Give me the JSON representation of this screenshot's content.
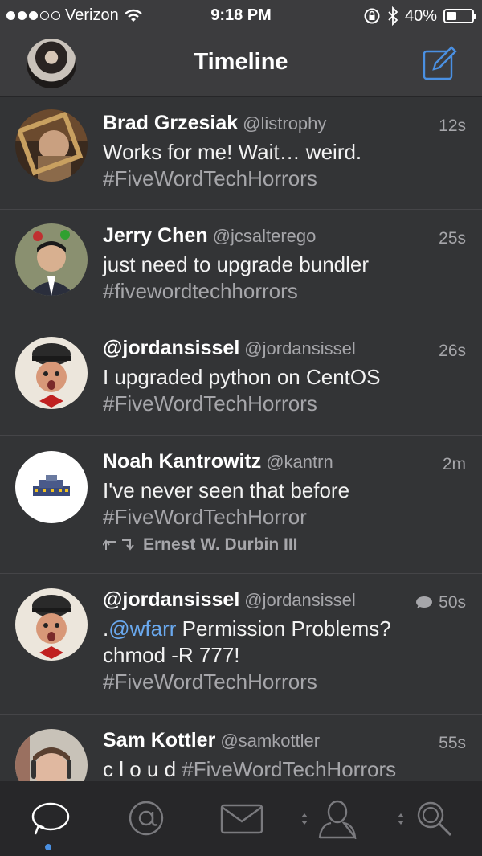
{
  "status": {
    "carrier": "Verizon",
    "time": "9:18 PM",
    "battery": "40%",
    "battery_level": 0.4
  },
  "nav": {
    "title": "Timeline"
  },
  "colors": {
    "accent": "#4a90e2",
    "mention": "#6aa9ef",
    "muted": "#a6a6aa"
  },
  "tweets": [
    {
      "name": "Brad Grzesiak",
      "handle": "@listrophy",
      "time": "12s",
      "text": "Works for me! Wait… weird.",
      "hashtag": "#FiveWordTechHorrors"
    },
    {
      "name": "Jerry Chen",
      "handle": "@jcsalterego",
      "time": "25s",
      "text": "just need to upgrade bundler",
      "hashtag": "#fivewordtechhorrors"
    },
    {
      "name": "@jordansissel",
      "handle": "@jordansissel",
      "time": "26s",
      "text": "I upgraded python on CentOS",
      "hashtag": "#FiveWordTechHorrors"
    },
    {
      "name": "Noah Kantrowitz",
      "handle": "@kantrn",
      "time": "2m",
      "text": "I've never seen that before",
      "hashtag": "#FiveWordTechHorror",
      "retweeted_by": "Ernest W. Durbin III"
    },
    {
      "name": "@jordansissel",
      "handle": "@jordansissel",
      "time": "50s",
      "prefix": ".",
      "mention": "@wfarr",
      "text": " Permission Problems?",
      "text2": "chmod -R 777!",
      "hashtag": "#FiveWordTechHorrors",
      "icon": "reply-bubble-icon"
    },
    {
      "name": "Sam Kottler",
      "handle": "@samkottler",
      "time": "55s",
      "text": "c l o u d ",
      "hashtag": "#FiveWordTechHorrors"
    }
  ],
  "tabs": [
    {
      "icon": "timeline-bubble-icon",
      "active": true
    },
    {
      "icon": "mentions-at-icon",
      "active": false
    },
    {
      "icon": "messages-envelope-icon",
      "active": false
    },
    {
      "icon": "profile-person-icon",
      "active": false
    },
    {
      "icon": "search-magnifier-icon",
      "active": false
    }
  ]
}
